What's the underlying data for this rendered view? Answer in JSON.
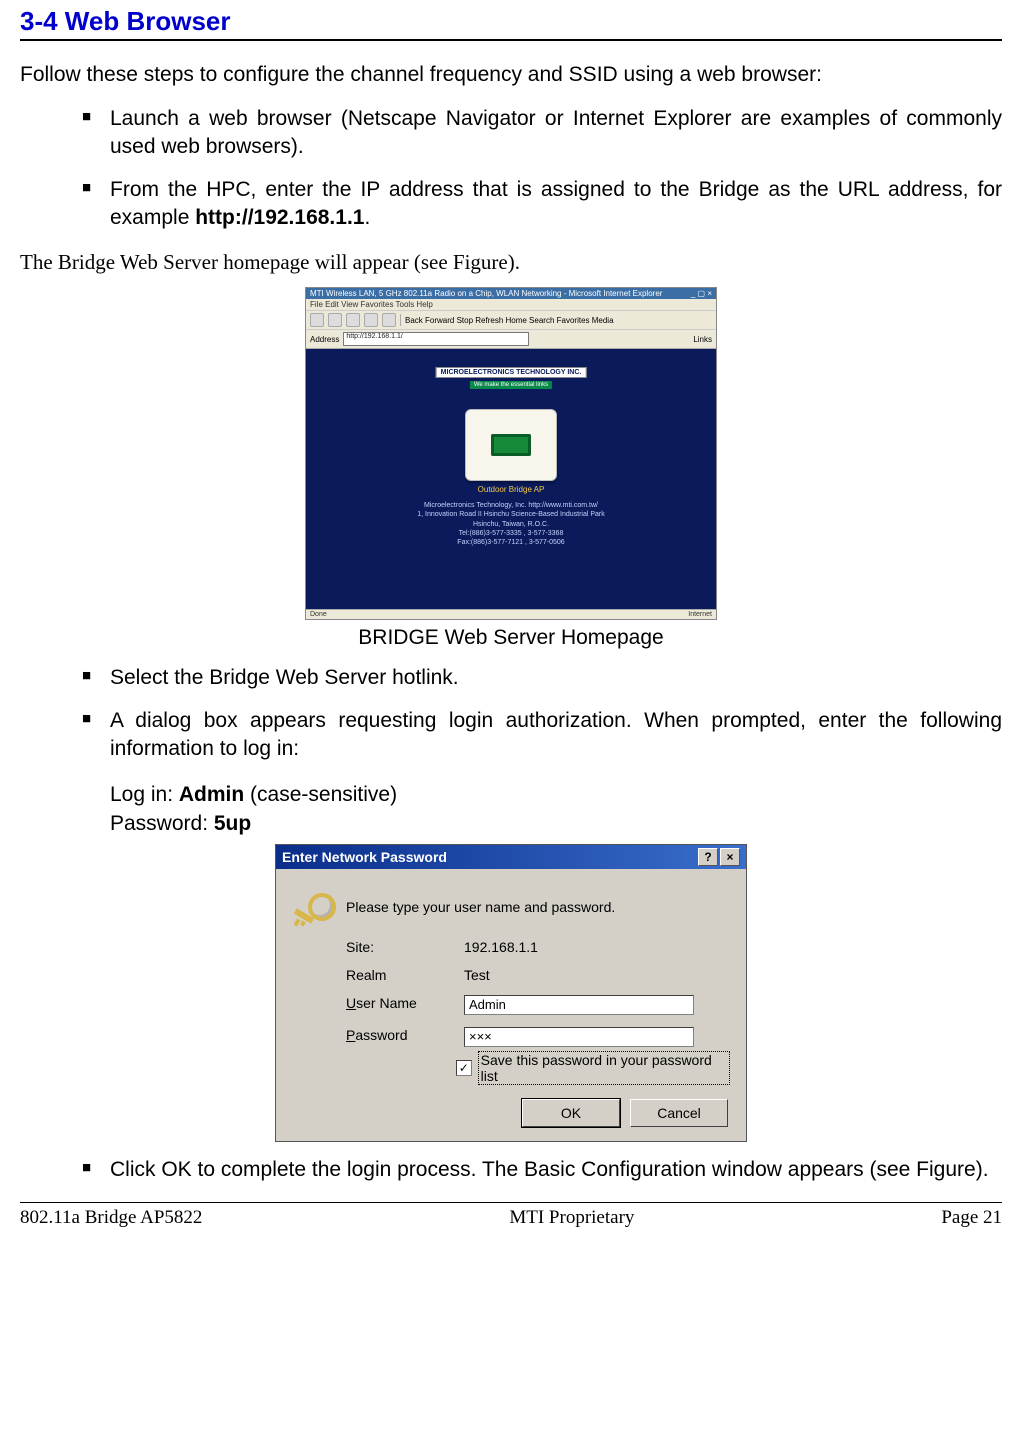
{
  "section_title": "3-4 Web Browser",
  "intro": "Follow these steps to configure the channel frequency and SSID using a web browser:",
  "bullets1": {
    "b1": "Launch a web browser (Netscape Navigator or Internet Explorer are examples of commonly used web browsers).",
    "b2_pre": "From the HPC, enter  the IP address that is assigned to the Bridge as the URL address, for example ",
    "b2_bold": "http://192.168.1.1",
    "b2_post": "."
  },
  "homepage_note": "The Bridge Web Server homepage will appear (see Figure).",
  "browser": {
    "title": "MTI Wireless LAN, 5 GHz 802.11a Radio on a Chip, WLAN Networking - Microsoft Internet Explorer",
    "menu": "File   Edit   View   Favorites   Tools   Help",
    "toolbar_labels": "Back  Forward  Stop  Refresh  Home   Search  Favorites  Media",
    "address_label": "Address",
    "address_value": "http://192.168.1.1/",
    "links_label": "Links",
    "logo_text": "MICROELECTRONICS TECHNOLOGY INC.",
    "tagline": "We make the essential links",
    "hotlink": "Outdoor Bridge AP",
    "info_l1": "Microelectronics Technology, Inc.  http://www.mti.com.tw/",
    "info_l2": "1, Innovation Road II Hsinchu Science-Based Industrial Park",
    "info_l3": "Hsinchu, Taiwan, R.O.C.",
    "info_l4": "Tel:(886)3-577-3335 , 3-577-3368",
    "info_l5": "Fax:(886)3-577-7121 , 3-577-0506",
    "status_left": "Done",
    "status_right": "Internet"
  },
  "fig1_caption": "BRIDGE Web Server Homepage",
  "bullets2": {
    "b3": "Select the Bridge Web Server hotlink.",
    "b4": "A dialog box appears requesting login authorization. When prompted, enter the following information to log in:"
  },
  "login": {
    "line1_pre": "Log in: ",
    "line1_bold": "Admin",
    "line1_post": " (case-sensitive)",
    "line2_pre": "Password: ",
    "line2_bold": "5up"
  },
  "pw_dialog": {
    "title": "Enter Network Password",
    "help_btn": "?",
    "close_btn": "×",
    "prompt": "Please type your user name and password.",
    "site_label": "Site:",
    "site_value": "192.168.1.1",
    "realm_label": "Realm",
    "realm_value": "Test",
    "user_label_pre": "U",
    "user_label_rest": "ser Name",
    "user_value": "Admin",
    "pass_label_pre": "P",
    "pass_label_rest": "assword",
    "pass_value": "×××",
    "check_state": "✓",
    "check_label_pre": "S",
    "check_label_rest": "ave this password in your password list",
    "ok": "OK",
    "cancel": "Cancel"
  },
  "bullets3": {
    "b5": "Click OK to complete the login process. The Basic Configuration window appears (see Figure)."
  },
  "footer": {
    "left": "802.11a Bridge  AP5822",
    "center": "MTI Proprietary",
    "right": "Page 21"
  }
}
